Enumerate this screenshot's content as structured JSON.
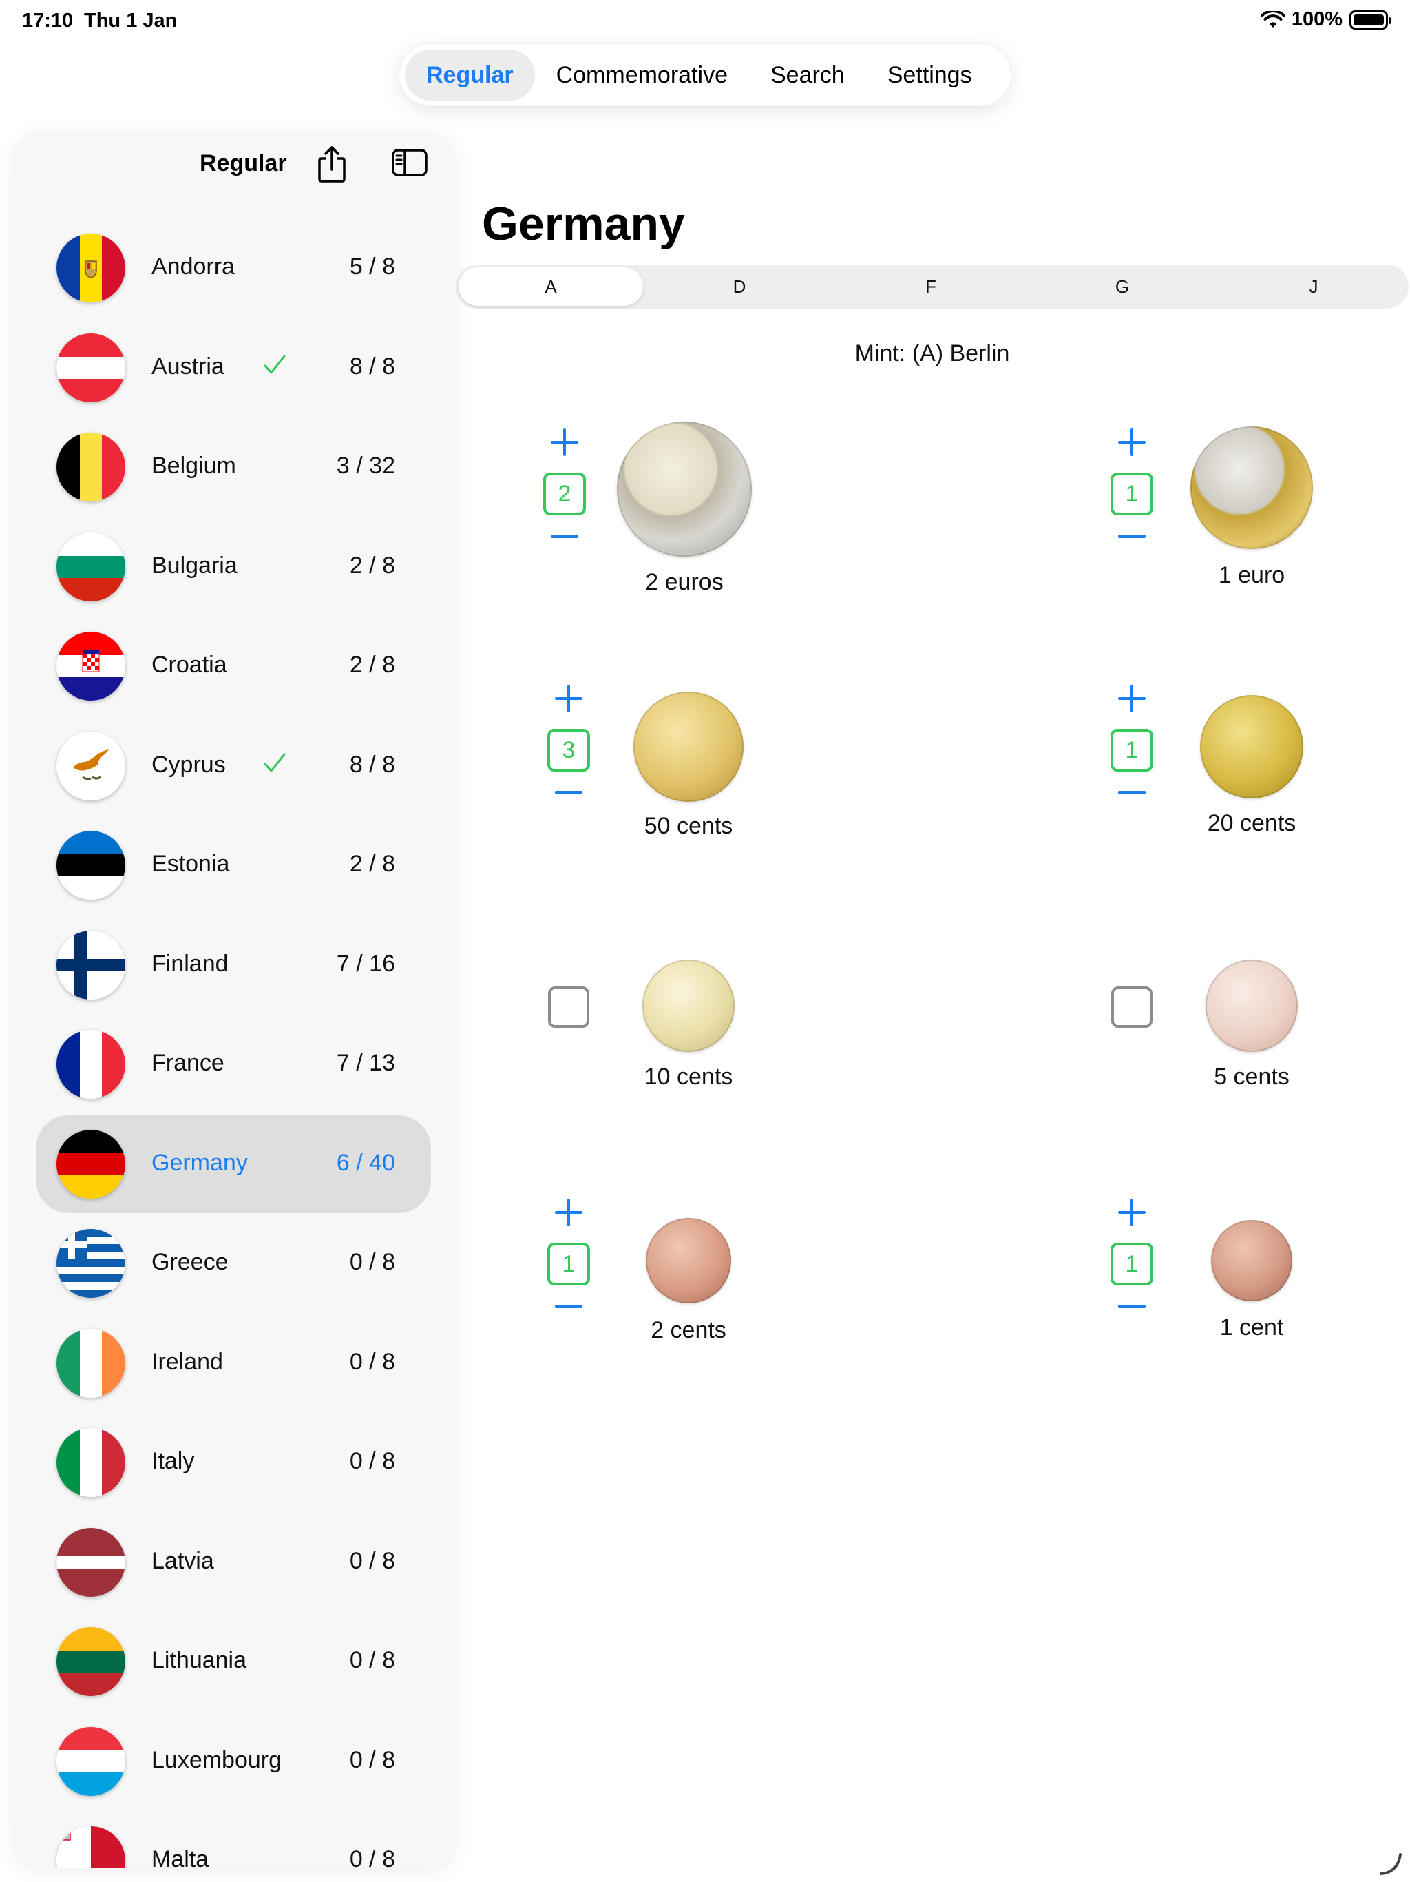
{
  "status": {
    "time": "17:10",
    "date": "Thu 1 Jan",
    "battery": "100%"
  },
  "top_tabs": [
    {
      "label": "Regular",
      "active": true
    },
    {
      "label": "Commemorative",
      "active": false
    },
    {
      "label": "Search",
      "active": false
    },
    {
      "label": "Settings",
      "active": false
    }
  ],
  "sidebar": {
    "title": "Regular",
    "countries": [
      {
        "name": "Andorra",
        "count": "5 / 8",
        "complete": false
      },
      {
        "name": "Austria",
        "count": "8 / 8",
        "complete": true
      },
      {
        "name": "Belgium",
        "count": "3 / 32",
        "complete": false
      },
      {
        "name": "Bulgaria",
        "count": "2 / 8",
        "complete": false
      },
      {
        "name": "Croatia",
        "count": "2 / 8",
        "complete": false
      },
      {
        "name": "Cyprus",
        "count": "8 / 8",
        "complete": true
      },
      {
        "name": "Estonia",
        "count": "2 / 8",
        "complete": false
      },
      {
        "name": "Finland",
        "count": "7 / 16",
        "complete": false
      },
      {
        "name": "France",
        "count": "7 / 13",
        "complete": false
      },
      {
        "name": "Germany",
        "count": "6 / 40",
        "complete": false,
        "selected": true
      },
      {
        "name": "Greece",
        "count": "0 / 8",
        "complete": false
      },
      {
        "name": "Ireland",
        "count": "0 / 8",
        "complete": false
      },
      {
        "name": "Italy",
        "count": "0 / 8",
        "complete": false
      },
      {
        "name": "Latvia",
        "count": "0 / 8",
        "complete": false
      },
      {
        "name": "Lithuania",
        "count": "0 / 8",
        "complete": false
      },
      {
        "name": "Luxembourg",
        "count": "0 / 8",
        "complete": false
      },
      {
        "name": "Malta",
        "count": "0 / 8",
        "complete": false
      }
    ]
  },
  "main": {
    "title": "Germany",
    "mint_tabs": [
      {
        "label": "A",
        "active": true
      },
      {
        "label": "D",
        "active": false
      },
      {
        "label": "F",
        "active": false
      },
      {
        "label": "G",
        "active": false
      },
      {
        "label": "J",
        "active": false
      }
    ],
    "mint_label": "Mint: (A) Berlin",
    "coins": [
      {
        "label": "2 euros",
        "quantity": "2"
      },
      {
        "label": "1 euro",
        "quantity": "1"
      },
      {
        "label": "50 cents",
        "quantity": "3"
      },
      {
        "label": "20 cents",
        "quantity": "1"
      },
      {
        "label": "10 cents",
        "quantity": ""
      },
      {
        "label": "5 cents",
        "quantity": ""
      },
      {
        "label": "2 cents",
        "quantity": "1"
      },
      {
        "label": "1 cent",
        "quantity": "1"
      }
    ]
  },
  "colors": {
    "accent": "#1a7df0",
    "check": "#34c759",
    "selected_row": "#dedede"
  },
  "icons": [
    "wifi-icon",
    "battery-icon",
    "share-icon",
    "sidebar-toggle-icon",
    "checkmark-icon",
    "plus-icon",
    "minus-icon",
    "resize-icon"
  ]
}
